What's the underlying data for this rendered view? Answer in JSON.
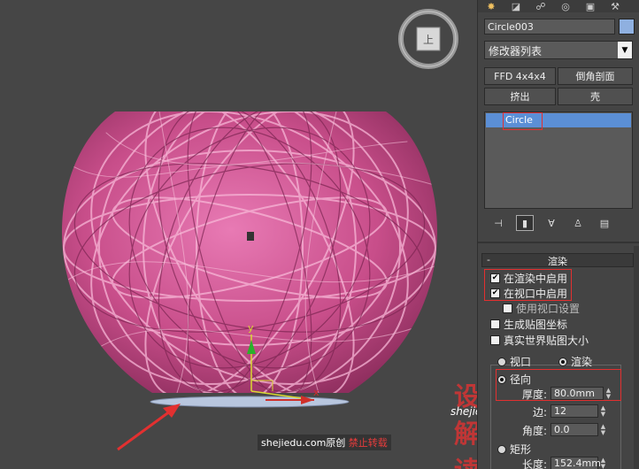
{
  "object": {
    "name": "Circle003",
    "color": "#8fb0e0"
  },
  "modifier_list": {
    "label": "修改器列表"
  },
  "modifier_buttons": {
    "ffd": "FFD 4x4x4",
    "chamfer": "倒角剖面",
    "extrude": "挤出",
    "shell": "壳"
  },
  "stack": {
    "items": [
      "Circle"
    ]
  },
  "rendering": {
    "rollout_title": "渲染",
    "collapse_symbol": "-",
    "enable_in_renderer": "在渲染中启用",
    "enable_in_viewport": "在视口中启用",
    "use_viewport_settings": "使用视口设置",
    "generate_mapping_coords": "生成贴图坐标",
    "real_world_map_size": "真实世界贴图大小",
    "viewport_option": "视口",
    "render_option": "渲染",
    "radial": "径向",
    "thickness_label": "厚度:",
    "thickness_value": "80.0mm",
    "sides_label": "边:",
    "sides_value": "12",
    "angle_label": "角度:",
    "angle_value": "0.0",
    "rectangular": "矩形",
    "length_label": "长度:",
    "length_value": "152.4mm"
  },
  "viewcube": {
    "face": "上"
  },
  "gizmo": {
    "axis_y": "y",
    "axis_x": "x"
  },
  "watermark": {
    "brand": "设解读",
    "url": "shejiedu.com",
    "footer_site": "shejiedu.com原创",
    "footer_forbid": "禁止转载"
  },
  "colors": {
    "accent_red": "#e23030",
    "selection_blue": "#5b8fd6",
    "mesh_pink": "#d45a96"
  }
}
